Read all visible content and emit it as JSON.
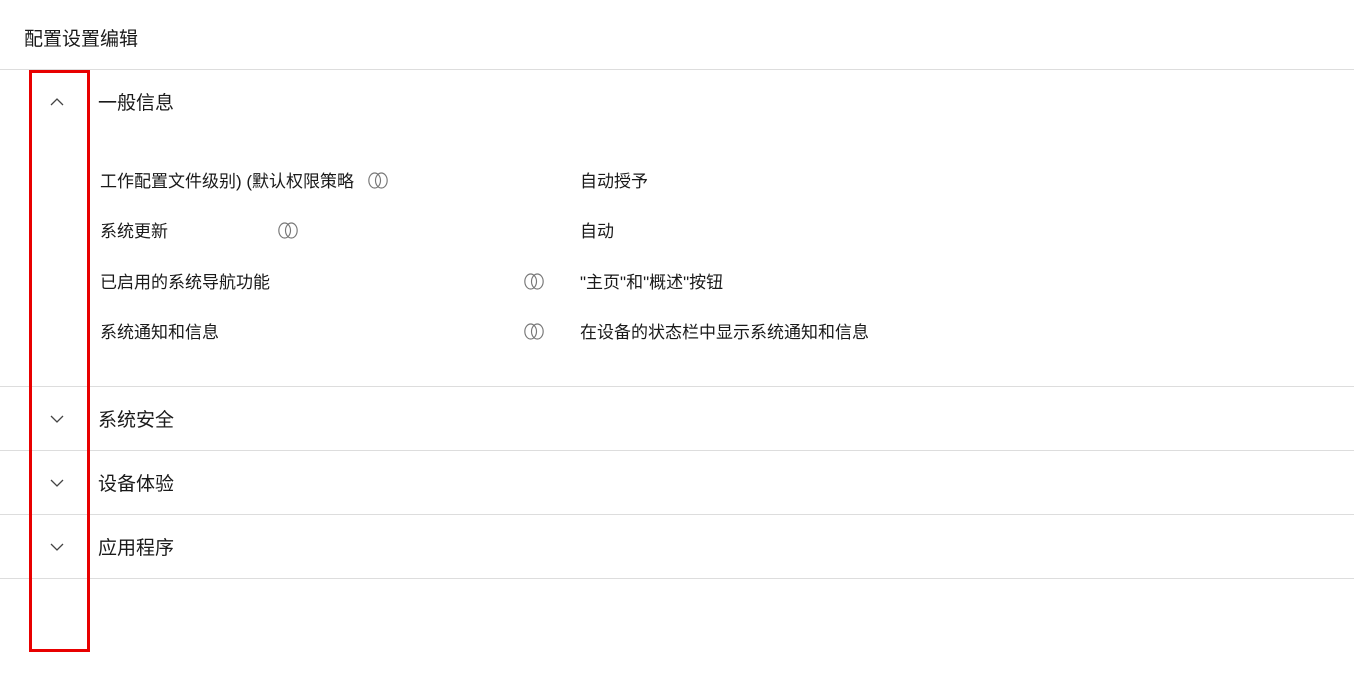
{
  "title": "配置设置编辑",
  "sections": [
    {
      "header": "一般信息",
      "expanded": true,
      "rows": [
        {
          "label": "工作配置文件级别) (默认权限策略",
          "value": "自动授予"
        },
        {
          "label": "系统更新",
          "value": "自动"
        },
        {
          "label": "已启用的系统导航功能",
          "value": "\"主页\"和\"概述\"按钮"
        },
        {
          "label": "系统通知和信息",
          "value": "在设备的状态栏中显示系统通知和信息"
        }
      ]
    },
    {
      "header": "系统安全",
      "expanded": false
    },
    {
      "header": "设备体验",
      "expanded": false
    },
    {
      "header": "应用程序",
      "expanded": false
    }
  ]
}
